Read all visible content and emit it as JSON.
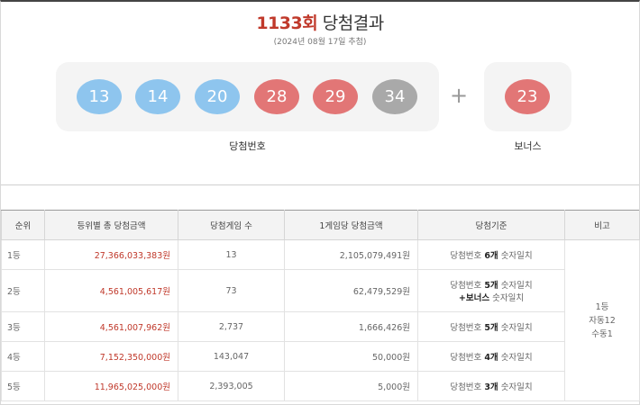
{
  "header": {
    "round": "1133회",
    "title_suffix": "당첨결과",
    "draw_date": "(2024년 08월 17일 추첨)"
  },
  "colors": {
    "ball_yellow_blue": "#80bfe8",
    "ball_red": "#e07070",
    "ball_gray": "#a8a8a8",
    "accent_red": "#c0392b"
  },
  "balls": {
    "winning": [
      {
        "number": "13",
        "color": "#8ec5ee"
      },
      {
        "number": "14",
        "color": "#8ec5ee"
      },
      {
        "number": "20",
        "color": "#8ec5ee"
      },
      {
        "number": "28",
        "color": "#e27676"
      },
      {
        "number": "29",
        "color": "#e27676"
      },
      {
        "number": "34",
        "color": "#a9a9a9"
      }
    ],
    "plus": "+",
    "bonus": {
      "number": "23",
      "color": "#e27676"
    },
    "winning_label": "당첨번호",
    "bonus_label": "보너스"
  },
  "table": {
    "headers": [
      "순위",
      "등위별 총 당첨금액",
      "당첨게임 수",
      "1게임당 당첨금액",
      "당첨기준",
      "비고"
    ],
    "rows": [
      {
        "rank": "1등",
        "total": "27,366,033,383원",
        "games": "13",
        "per_game": "2,105,079,491원",
        "criteria_pre": "당첨번호 ",
        "criteria_em": "6개",
        "criteria_post": " 숫자일치",
        "criteria_line2": ""
      },
      {
        "rank": "2등",
        "total": "4,561,005,617원",
        "games": "73",
        "per_game": "62,479,529원",
        "criteria_pre": "당첨번호 ",
        "criteria_em": "5개",
        "criteria_post": " 숫자일치",
        "criteria_line2_em": "+보너스",
        "criteria_line2": " 숫자일치"
      },
      {
        "rank": "3등",
        "total": "4,561,007,962원",
        "games": "2,737",
        "per_game": "1,666,426원",
        "criteria_pre": "당첨번호 ",
        "criteria_em": "5개",
        "criteria_post": " 숫자일치",
        "criteria_line2": ""
      },
      {
        "rank": "4등",
        "total": "7,152,350,000원",
        "games": "143,047",
        "per_game": "50,000원",
        "criteria_pre": "당첨번호 ",
        "criteria_em": "4개",
        "criteria_post": " 숫자일치",
        "criteria_line2": ""
      },
      {
        "rank": "5등",
        "total": "11,965,025,000원",
        "games": "2,393,005",
        "per_game": "5,000원",
        "criteria_pre": "당첨번호 ",
        "criteria_em": "3개",
        "criteria_post": " 숫자일치",
        "criteria_line2": ""
      }
    ],
    "note": {
      "line1": "1등",
      "line2": "자동12",
      "line3": "수동1"
    }
  }
}
